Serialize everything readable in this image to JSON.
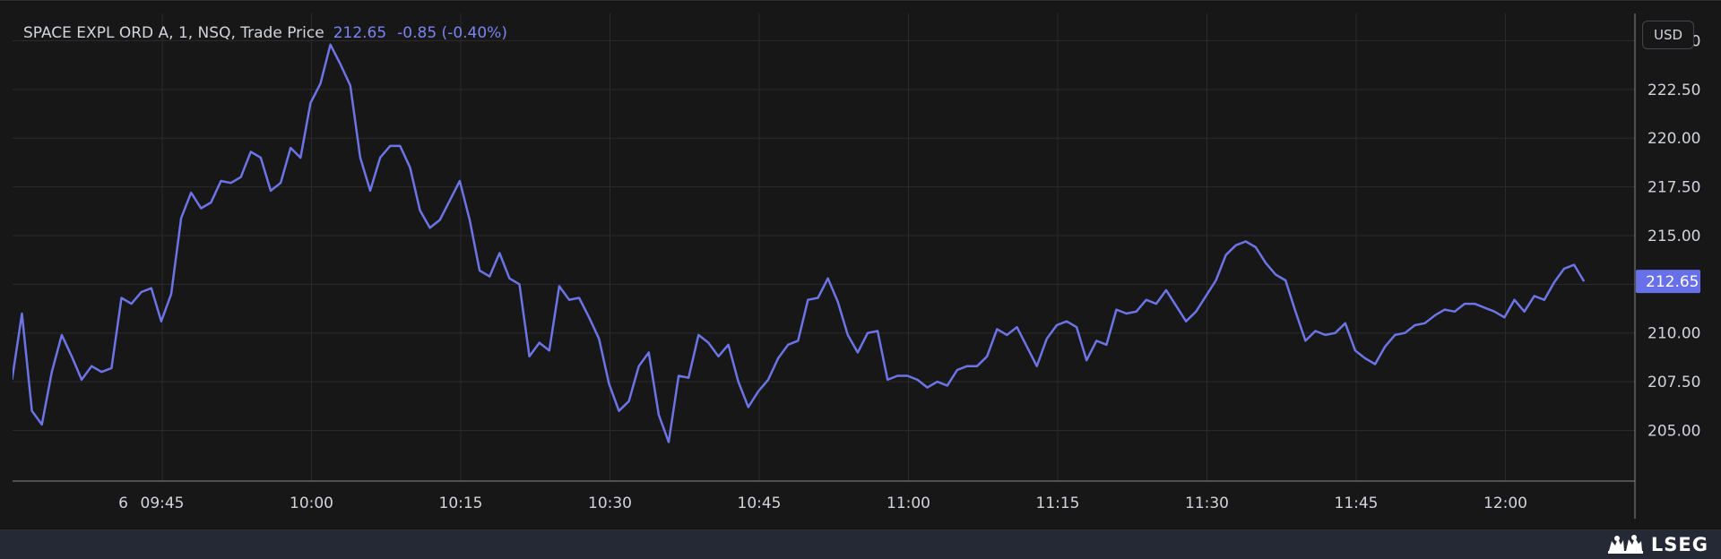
{
  "header": {
    "instrument": "SPACE EXPL ORD A, 1, NSQ, Trade Price",
    "last_price": "212.65",
    "change": "-0.85 (-0.40%)"
  },
  "currency_button": "USD",
  "brand": {
    "name": "LSEG",
    "logo_icon": "lseg-lion-logo"
  },
  "colors": {
    "line": "#6c74e6",
    "price_label_bg": "#6770e8",
    "background": "#171717",
    "grid": "#2a2a2a",
    "text": "#d1d4dc"
  },
  "chart_data": {
    "type": "line",
    "title": "SPACE EXPL ORD A, 1, NSQ, Trade Price",
    "currency": "USD",
    "last_price_label": "212.65",
    "x_tick_labels": [
      "6",
      "09:45",
      "10:00",
      "10:15",
      "10:30",
      "10:45",
      "11:00",
      "11:15",
      "11:30",
      "11:45",
      "12:00"
    ],
    "x_tick_minutes": [
      -4.4,
      0,
      15,
      30,
      45,
      60,
      75,
      90,
      105,
      120,
      135
    ],
    "y_tick_labels": [
      "205.00",
      "207.50",
      "210.00",
      "212.50",
      "215.00",
      "217.50",
      "220.00",
      "222.50",
      "225.00"
    ],
    "y_tick_values": [
      205,
      207.5,
      210,
      212.5,
      215,
      217.5,
      220,
      222.5,
      225
    ],
    "ylim": [
      202.4,
      226.4
    ],
    "grid": true,
    "x_unit": "minutes after 09:45",
    "x": [
      -15.1,
      -14.1,
      -13.1,
      -12.1,
      -11.1,
      -10.1,
      -9.1,
      -8.1,
      -7.1,
      -6.1,
      -5.1,
      -4.1,
      -3.1,
      -2.1,
      -1.1,
      -0.1,
      0.9,
      1.9,
      2.9,
      3.9,
      4.9,
      5.9,
      6.9,
      7.9,
      8.9,
      9.9,
      10.9,
      11.9,
      12.9,
      13.9,
      14.9,
      15.9,
      16.9,
      17.9,
      18.9,
      19.9,
      20.9,
      21.9,
      22.9,
      23.9,
      24.9,
      25.9,
      26.9,
      27.9,
      28.9,
      29.9,
      30.9,
      31.9,
      32.9,
      33.9,
      34.9,
      35.9,
      36.9,
      37.9,
      38.9,
      39.9,
      40.9,
      41.9,
      42.9,
      43.9,
      44.9,
      45.9,
      46.9,
      47.9,
      48.9,
      49.9,
      50.9,
      51.9,
      52.9,
      53.9,
      54.9,
      55.9,
      56.9,
      57.9,
      58.9,
      59.9,
      60.9,
      61.9,
      62.9,
      63.9,
      64.9,
      65.9,
      66.9,
      67.9,
      68.9,
      69.9,
      70.9,
      71.9,
      72.9,
      73.9,
      74.9,
      75.9,
      76.9,
      77.9,
      78.9,
      79.9,
      80.9,
      81.9,
      82.9,
      83.9,
      84.9,
      85.9,
      86.9,
      87.9,
      88.9,
      89.9,
      90.9,
      91.9,
      92.9,
      93.9,
      94.9,
      95.9,
      96.9,
      97.9,
      98.9,
      99.9,
      100.9,
      101.9,
      102.9,
      103.9,
      104.9,
      105.9,
      106.9,
      107.9,
      108.9,
      109.9,
      110.9,
      111.9,
      112.9,
      113.9,
      114.9,
      115.9,
      116.9,
      117.9,
      118.9,
      119.9,
      120.9,
      121.9,
      122.9,
      123.9,
      124.9,
      125.9,
      126.9,
      127.9,
      128.9,
      129.9,
      130.9,
      131.9,
      132.9,
      133.9,
      134.9,
      135.9,
      136.9,
      137.9,
      138.9,
      139.9,
      140.9,
      141.9,
      142.9,
      143.9,
      144.9
    ],
    "values": [
      207.6,
      211.0,
      206.0,
      205.3,
      208.0,
      209.9,
      208.8,
      207.6,
      208.3,
      208.0,
      208.2,
      211.8,
      211.5,
      212.1,
      212.3,
      210.6,
      212.0,
      215.9,
      217.2,
      216.4,
      216.7,
      217.8,
      217.7,
      218.0,
      219.3,
      219.0,
      217.3,
      217.7,
      219.5,
      219.0,
      221.8,
      222.8,
      224.8,
      223.8,
      222.7,
      219.0,
      217.3,
      219.0,
      219.6,
      219.6,
      218.5,
      216.3,
      215.4,
      215.8,
      216.8,
      217.8,
      215.8,
      213.2,
      212.9,
      214.1,
      212.8,
      212.5,
      208.8,
      209.5,
      209.1,
      212.4,
      211.7,
      211.8,
      210.8,
      209.7,
      207.4,
      206.0,
      206.5,
      208.3,
      209.0,
      205.8,
      204.4,
      207.8,
      207.7,
      209.9,
      209.5,
      208.8,
      209.4,
      207.5,
      206.2,
      207.0,
      207.6,
      208.7,
      209.4,
      209.6,
      211.7,
      211.8,
      212.8,
      211.6,
      209.9,
      209.0,
      210.0,
      210.1,
      207.6,
      207.8,
      207.8,
      207.6,
      207.2,
      207.5,
      207.3,
      208.1,
      208.3,
      208.3,
      208.8,
      210.2,
      209.9,
      210.3,
      209.3,
      208.3,
      209.7,
      210.4,
      210.6,
      210.3,
      208.6,
      209.6,
      209.4,
      211.2,
      211.0,
      211.1,
      211.7,
      211.5,
      212.2,
      211.4,
      210.6,
      211.1,
      211.9,
      212.7,
      214.0,
      214.5,
      214.7,
      214.4,
      213.6,
      213.0,
      212.7,
      211.1,
      209.6,
      210.1,
      209.9,
      210.0,
      210.5,
      209.1,
      208.7,
      208.4,
      209.3,
      209.9,
      210.0,
      210.4,
      210.5,
      210.9,
      211.2,
      211.1,
      211.5,
      211.5,
      211.3,
      211.1,
      210.8,
      211.7,
      211.1,
      211.9,
      211.7,
      212.6,
      213.3,
      213.5,
      212.65
    ]
  }
}
